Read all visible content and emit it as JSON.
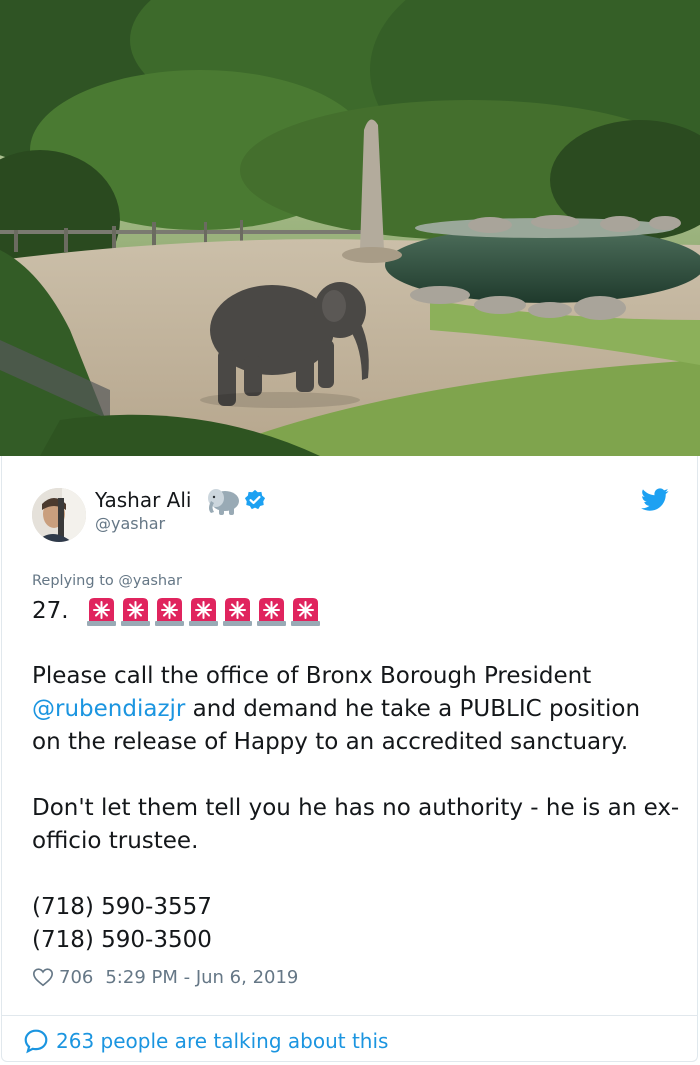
{
  "photo": {
    "subject": "elephant-in-zoo-enclosure"
  },
  "tweet": {
    "author_name": "Yashar Ali",
    "author_handle": "@yashar",
    "replying_prefix": "Replying to",
    "replying_handle": "@yashar",
    "number": "27.",
    "siren_count": 7,
    "body": {
      "line1": "Please call the office of Bronx Borough President",
      "mention": "@rubendiazjr",
      "line2_rest": " and demand he take a PUBLIC position",
      "line3": "on the release of Happy to an accredited sanctuary.",
      "para2": "Don't let them tell you he has no authority - he is an ex-officio trustee.",
      "phone1": "(718) 590-3557",
      "phone2": "(718) 590-3500"
    },
    "likes": "706",
    "timestamp": "5:29 PM - Jun 6, 2019",
    "talking": "263 people are talking about this"
  },
  "colors": {
    "link": "#1b95e0",
    "muted": "#657786",
    "text": "#14171a",
    "siren_red": "#e0245e"
  },
  "icons": [
    "elephant-emoji-icon",
    "verified-badge-icon",
    "twitter-bird-icon",
    "police-light-icon",
    "heart-icon",
    "speech-bubble-icon"
  ]
}
